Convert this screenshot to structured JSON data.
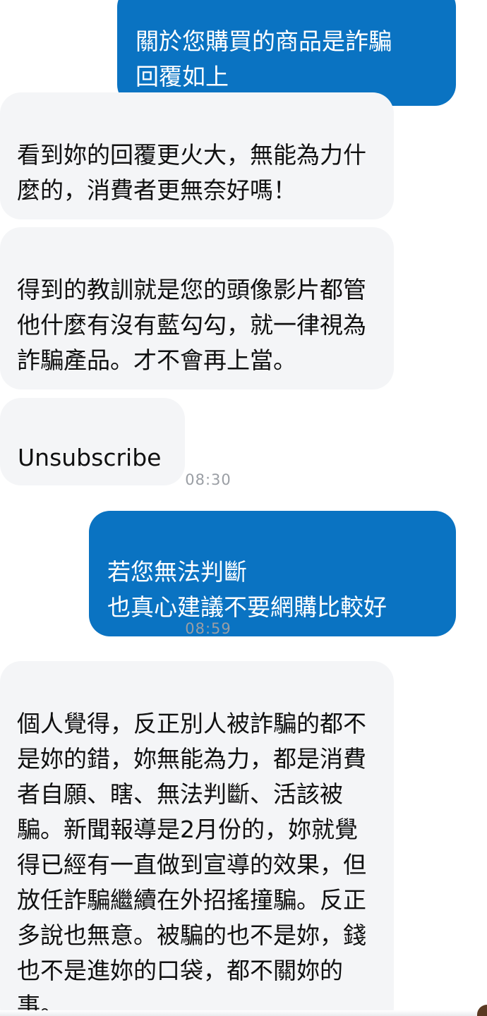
{
  "messages": {
    "m1": {
      "text": "關於您購買的商品是詐騙\n回覆如上"
    },
    "m2": {
      "text": "看到妳的回覆更火大，無能為力什麼的，消費者更無奈好嗎！"
    },
    "m3": {
      "text": "得到的教訓就是您的頭像影片都管他什麼有沒有藍勾勾，就一律視為詐騙產品。才不會再上當。"
    },
    "m4": {
      "text": "Unsubscribe"
    },
    "m5": {
      "text": "若您無法判斷\n也真心建議不要網購比較好"
    },
    "m6": {
      "text": "個人覺得，反正別人被詐騙的都不是妳的錯，妳無能為力，都是消費者自願、瞎、無法判斷、活該被騙。新聞報導是2月份的，妳就覺得已經有一直做到宣導的效果，但放任詐騙繼續在外招搖撞騙。反正多說也無意。被騙的也不是妳，錢也不是進妳的口袋，都不關妳的事。"
    }
  },
  "timestamps": {
    "t1": "08:30",
    "t2": "08:59"
  },
  "colors": {
    "outgoing_bubble": "#0a73c2",
    "incoming_bubble": "#f4f5f7",
    "timestamp_text": "#9a9ea4"
  }
}
